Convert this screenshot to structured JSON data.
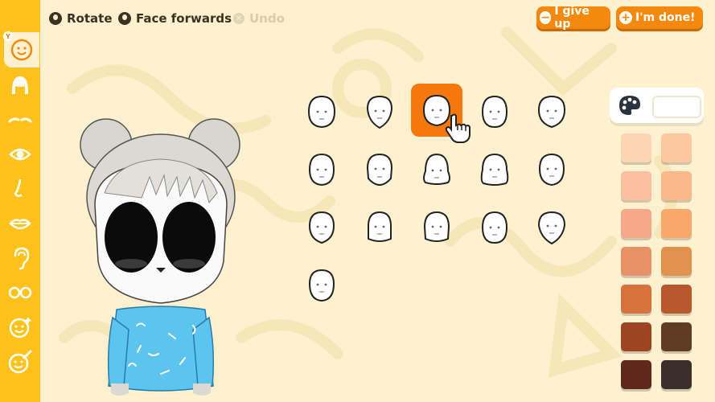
{
  "top_controls": {
    "rotate_label": "Rotate",
    "face_forwards_label": "Face forwards",
    "undo_label": "Undo"
  },
  "buttons": {
    "give_up_label": "I give up",
    "done_label": "I'm done!"
  },
  "sidebar": {
    "badge": "Y",
    "items": [
      {
        "name": "face-shape",
        "icon": "face-icon",
        "selected": true
      },
      {
        "name": "hair",
        "icon": "hair-icon"
      },
      {
        "name": "eyebrows",
        "icon": "eyebrows-icon"
      },
      {
        "name": "eyes",
        "icon": "eye-icon"
      },
      {
        "name": "nose",
        "icon": "nose-icon"
      },
      {
        "name": "mouth",
        "icon": "lips-icon"
      },
      {
        "name": "ears",
        "icon": "ear-icon"
      },
      {
        "name": "glasses",
        "icon": "glasses-icon"
      },
      {
        "name": "face-features",
        "icon": "sparkle-face-icon"
      },
      {
        "name": "face-paint",
        "icon": "brush-face-icon"
      }
    ]
  },
  "face_options": {
    "count": 16,
    "selected_index": 2
  },
  "palette": {
    "icon": "palette-icon",
    "colors": [
      [
        "#fcd5b5",
        "#fcc99f"
      ],
      [
        "#fcbfa0",
        "#fcb88a"
      ],
      [
        "#f8a888",
        "#f9a76a"
      ],
      [
        "#e99168",
        "#e0924e"
      ],
      [
        "#d9733e",
        "#b9582c"
      ],
      [
        "#9c4520",
        "#603c24"
      ],
      [
        "#60281a",
        "#3a2f2a"
      ]
    ]
  },
  "colors": {
    "sidebar": "#ffc21c",
    "accent": "#f4890e",
    "background": "#fdf1cf"
  }
}
